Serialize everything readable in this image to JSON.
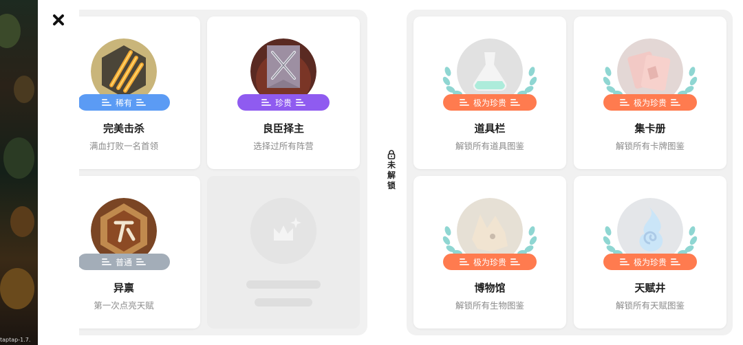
{
  "version_text": "taptap-1.7.",
  "lock_section": {
    "label_chars": [
      "未",
      "解",
      "锁"
    ]
  },
  "achievements_unlocked": [
    {
      "title": "完美击杀",
      "desc": "满血打败一名首领",
      "rarity": "稀有",
      "rarity_color": "#5b9bf4",
      "icon": "claw-slash-icon"
    },
    {
      "title": "良臣择主",
      "desc": "选择过所有阵营",
      "rarity": "珍贵",
      "rarity_color": "#8f5bf0",
      "icon": "crossed-swords-banner-icon"
    },
    {
      "title": "异禀",
      "desc": "第一次点亮天赋",
      "rarity": "普通",
      "rarity_color": "#a3adb8",
      "icon": "talent-rune-icon"
    }
  ],
  "achievements_locked": [
    {
      "title": "道具栏",
      "desc": "解锁所有道具图鉴",
      "rarity": "极为珍贵",
      "rarity_color": "#ff7b4f",
      "icon": "potion-flask-icon"
    },
    {
      "title": "集卡册",
      "desc": "解锁所有卡牌图鉴",
      "rarity": "极为珍贵",
      "rarity_color": "#ff7b4f",
      "icon": "card-deck-icon"
    },
    {
      "title": "博物馆",
      "desc": "解锁所有生物图鉴",
      "rarity": "极为珍贵",
      "rarity_color": "#ff7b4f",
      "icon": "beast-head-icon"
    },
    {
      "title": "天赋井",
      "desc": "解锁所有天赋图鉴",
      "rarity": "极为珍贵",
      "rarity_color": "#ff7b4f",
      "icon": "spiral-flame-icon"
    }
  ],
  "colors": {
    "laurel": "#8fd6d2",
    "panel_bg": "#f1f1f1"
  }
}
